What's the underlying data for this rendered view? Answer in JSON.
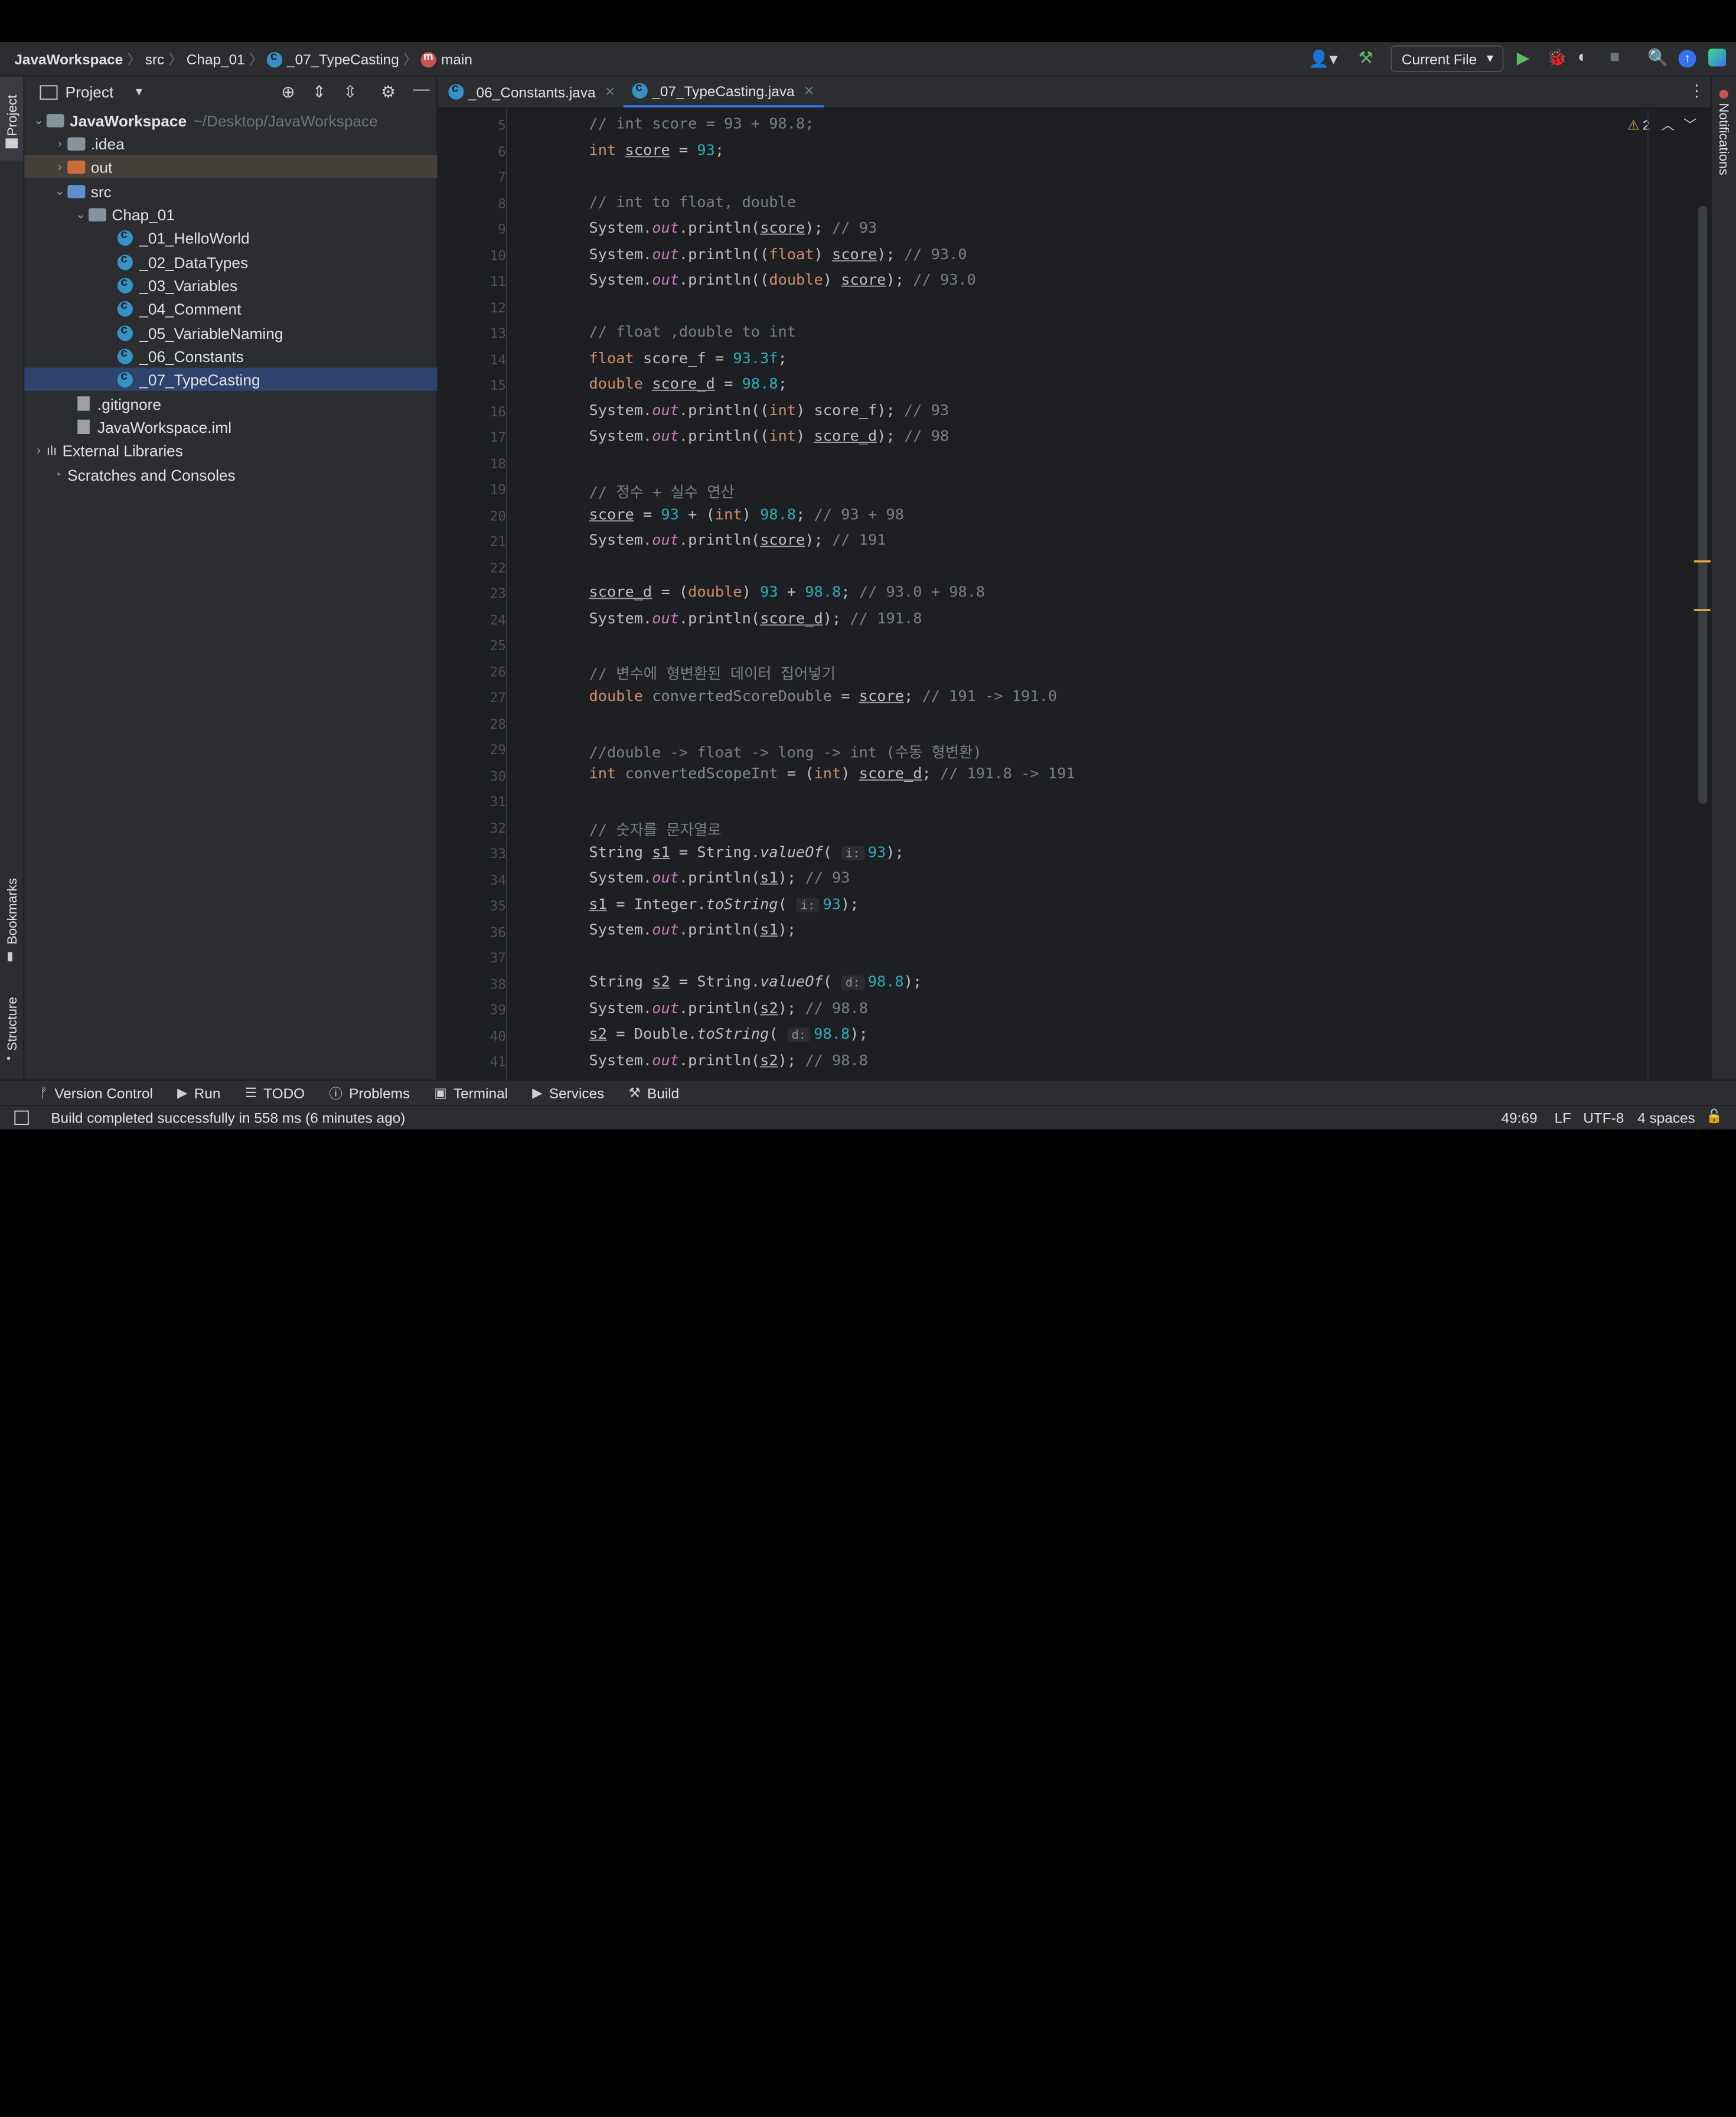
{
  "breadcrumb": {
    "project": "JavaWorkspace",
    "src": "src",
    "pkg": "Chap_01",
    "cls": "_07_TypeCasting",
    "method": "main"
  },
  "toolbar": {
    "run_config": "Current File"
  },
  "project_panel": {
    "title": "Project",
    "root_name": "JavaWorkspace",
    "root_path": "~/Desktop/JavaWorkspace",
    "items": [
      {
        "label": ".idea"
      },
      {
        "label": "out"
      },
      {
        "label": "src"
      },
      {
        "label": "Chap_01"
      },
      {
        "label": "_01_HelloWorld"
      },
      {
        "label": "_02_DataTypes"
      },
      {
        "label": "_03_Variables"
      },
      {
        "label": "_04_Comment"
      },
      {
        "label": "_05_VariableNaming"
      },
      {
        "label": "_06_Constants"
      },
      {
        "label": "_07_TypeCasting"
      },
      {
        "label": ".gitignore"
      },
      {
        "label": "JavaWorkspace.iml"
      },
      {
        "label": "External Libraries"
      },
      {
        "label": "Scratches and Consoles"
      }
    ]
  },
  "left_strip": {
    "project": "Project",
    "bookmarks": "Bookmarks",
    "structure": "Structure"
  },
  "right_strip": {
    "notifications": "Notifications"
  },
  "tabs": [
    {
      "label": "_06_Constants.java"
    },
    {
      "label": "_07_TypeCasting.java"
    }
  ],
  "editor": {
    "warnings": "2",
    "line_numbers": [
      "5",
      "6",
      "7",
      "8",
      "9",
      "10",
      "11",
      "12",
      "13",
      "14",
      "15",
      "16",
      "17",
      "18",
      "19",
      "20",
      "21",
      "22",
      "23",
      "24",
      "25",
      "26",
      "27",
      "28",
      "29",
      "30",
      "31",
      "32",
      "33",
      "34",
      "35",
      "36",
      "37",
      "38",
      "39",
      "40",
      "41"
    ]
  },
  "bottom_toolbar": {
    "version_control": "Version Control",
    "run": "Run",
    "todo": "TODO",
    "problems": "Problems",
    "terminal": "Terminal",
    "services": "Services",
    "build": "Build"
  },
  "status": {
    "message": "Build completed successfully in 558 ms (6 minutes ago)",
    "position": "49:69",
    "line_sep": "LF",
    "encoding": "UTF-8",
    "indent": "4 spaces"
  }
}
